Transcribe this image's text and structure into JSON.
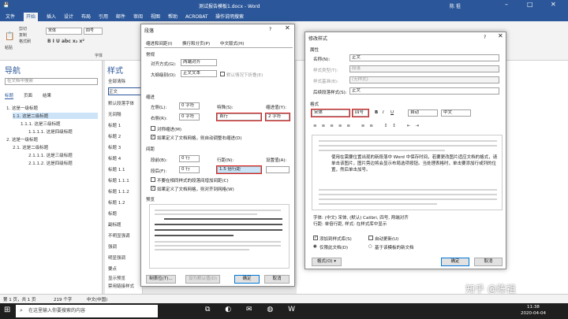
{
  "window": {
    "title": "测试报告模板1.docx - Word",
    "user": "陈 祖"
  },
  "ribbon": {
    "tabs": [
      "文件",
      "开始",
      "插入",
      "设计",
      "布局",
      "引用",
      "邮件",
      "审阅",
      "视图",
      "帮助",
      "ACROBAT",
      "操作说明搜索"
    ],
    "clipboard": {
      "cut": "剪切",
      "copy": "复制",
      "format_painter": "格式刷",
      "paste": "粘贴"
    },
    "font_name": "宋体",
    "font_size": "四号",
    "font_group": "字体"
  },
  "nav": {
    "title": "导航",
    "search_placeholder": "在文档中搜索",
    "tabs": [
      "标题",
      "页面",
      "结果"
    ],
    "items": [
      "1. 这是一级标题",
      "1.1. 这是二级标题",
      "1.1.1. 这是三级标题",
      "1.1.1.1. 这是四级标题",
      "2. 这是一级标题",
      "2.1. 这是二级标题",
      "2.1.1.1. 这是三级标题",
      "2.1.1.2. 这是四级标题"
    ]
  },
  "styles": {
    "title": "样式",
    "items": [
      "全部清除",
      "正文",
      "默认段落字体",
      "无间隔",
      "标题 1",
      "标题 2",
      "标题 3",
      "标题 4",
      "标题 1.1",
      "标题 1.1.1",
      "标题 1.1.2",
      "标题 1.2",
      "标题",
      "副标题",
      "不明显强调",
      "强调",
      "明显强调",
      "要点"
    ],
    "show_preview": "显示预览",
    "disable_linked": "禁用链接样式"
  },
  "paragraph": {
    "title": "段落",
    "help": "?",
    "tabs": [
      "缩进和间距(I)",
      "换行和分页(P)",
      "中文版式(H)"
    ],
    "general": "常规",
    "align_label": "对齐方式(G):",
    "align_value": "两端对齐",
    "outline_label": "大纲级别(O):",
    "outline_value": "正文文本",
    "collapse_label": "默认情况下折叠(E)",
    "indent": "缩进",
    "left_label": "左侧(L):",
    "left_value": "0 字符",
    "right_label": "右侧(R):",
    "right_value": "0 字符",
    "special_label": "特殊(S):",
    "special_value": "首行",
    "indent_amount_label": "缩进值(Y):",
    "indent_amount_value": "2 字符",
    "mirror": "对称缩进(M)",
    "auto_adjust": "如果定义了文档网格，则自动调整右缩进(D)",
    "spacing": "间距",
    "before_label": "段前(B):",
    "before_value": "0 行",
    "after_label": "段后(F):",
    "after_value": "0 行",
    "line_label": "行距(N):",
    "line_value": "1.5 倍行距",
    "at_label": "设置值(A):",
    "at_value": "",
    "no_space": "不要在相同样式的段落间增加间距(C)",
    "snap_grid": "如果定义了文档网格，则对齐到网格(W)",
    "preview": "预览",
    "tabs_button": "制表位(T)...",
    "default_button": "设为默认值(D)",
    "ok": "确定",
    "cancel": "取消"
  },
  "modify": {
    "title": "修改样式",
    "help": "?",
    "properties": "属性",
    "name_label": "名称(N):",
    "name_value": "正文",
    "type_label": "样式类型(T):",
    "type_value": "段落",
    "based_label": "样式基准(B):",
    "based_value": "(无样式)",
    "follow_label": "后续段落样式(S):",
    "follow_value": "正文",
    "format": "格式",
    "font_value": "宋体",
    "size_value": "四号",
    "color_value": "自动",
    "lang_value": "中文",
    "sample_text": "使用在需要位置出现的新段落中 Word 中保存时间，若要更改图片适应文档的格式，请单击该图片，图片旁边将会显示布局选项按钮。当处理表格时，单击要添加行或列的位置，然后单击加号。",
    "desc": "字体: (中文) 宋体, (默认) Calibri, 四号, 两端对齐\n行距: 单倍行距, 样式: 在样式库中显示",
    "add_gallery": "添加到样式库(S)",
    "auto_update": "自动更新(U)",
    "only_doc": "仅限此文档(D)",
    "new_docs": "基于该模板的新文档",
    "format_button": "格式(O) ▾",
    "ok": "确定",
    "cancel": "取消"
  },
  "status": {
    "page": "第 1 页，共 1 页",
    "words": "219 个字",
    "lang": "中文(中国)"
  },
  "taskbar": {
    "search": "在这里输入你要搜索的内容",
    "time": "11:38",
    "date": "2020-04-04",
    "watermark": "知乎 @陈祖"
  },
  "colors": {
    "accent": "#2b579a",
    "highlight": "#e02020"
  }
}
